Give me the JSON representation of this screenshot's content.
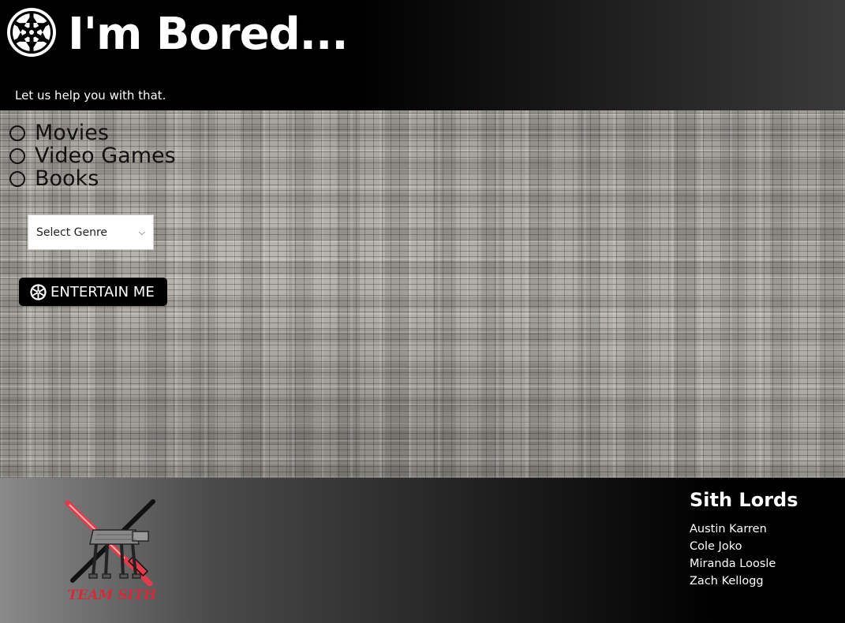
{
  "header": {
    "title": "I'm Bored...",
    "tagline": "Let us help you with that.",
    "logo_icon": "imperial-emblem-icon"
  },
  "main": {
    "media_options": [
      {
        "label": "Movies",
        "selected": false
      },
      {
        "label": "Video Games",
        "selected": false
      },
      {
        "label": "Books",
        "selected": false
      }
    ],
    "genre_select": {
      "selected": "Select Genre"
    },
    "entertain_button": {
      "label": "ENTERTAIN ME",
      "icon": "imperial-emblem-icon"
    }
  },
  "footer": {
    "logo_text": "TEAM SITH",
    "credits_title": "Sith Lords",
    "credits": [
      "Austin Karren",
      "Cole Joko",
      "Miranda Loosle",
      "Zach Kellogg"
    ]
  },
  "colors": {
    "header_bg": "#000000",
    "button_bg": "#000000",
    "lightsaber_red": "#e23b4a",
    "logo_text_red": "#d22b3a"
  }
}
